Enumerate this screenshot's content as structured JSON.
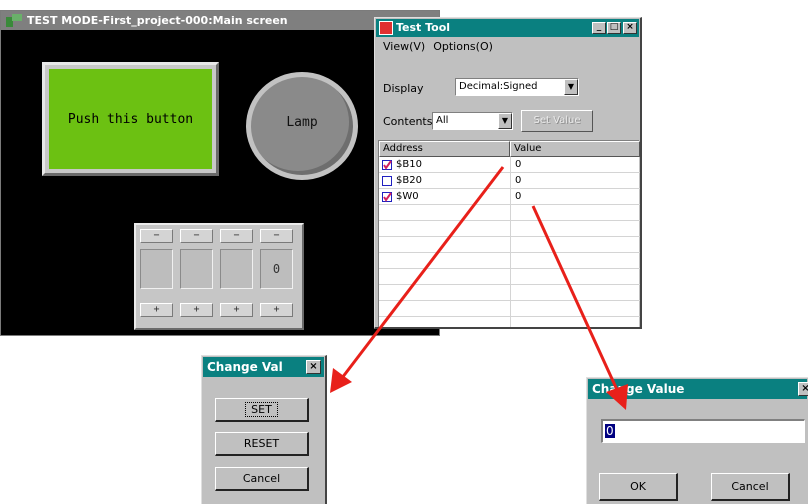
{
  "main_window": {
    "title": "TEST MODE-First_project-000:Main screen",
    "push_button_label": "Push this button",
    "lamp_label": "Lamp",
    "numpad": {
      "minus_labels": [
        "−",
        "−",
        "−",
        "−"
      ],
      "display_values": [
        "",
        "",
        "",
        "0"
      ],
      "plus_labels": [
        "+",
        "+",
        "+",
        "+"
      ]
    }
  },
  "test_tool": {
    "title": "Test Tool",
    "menu": {
      "view": "View(V)",
      "options": "Options(O)"
    },
    "display_label": "Display",
    "display_value": "Decimal:Signed",
    "contents_label": "Contents",
    "contents_value": "All",
    "set_value_button": "Set Value",
    "columns": {
      "address": "Address",
      "value": "Value"
    },
    "rows": [
      {
        "address": "$B10",
        "value": "0"
      },
      {
        "address": "$B20",
        "value": "0"
      },
      {
        "address": "$W0",
        "value": "0"
      }
    ]
  },
  "change_val_dialog": {
    "title": "Change Val",
    "close": "×",
    "set_button": "SET",
    "reset_button": "RESET",
    "cancel_button": "Cancel"
  },
  "change_value_dialog": {
    "title": "Change Value",
    "close": "×",
    "input_value": "0",
    "ok_button": "OK",
    "cancel_button": "Cancel"
  },
  "colors": {
    "titlebar_active": "#0a8080",
    "titlebar_inactive": "#7f7f7f",
    "push_button_face": "#6cc112",
    "arrow": "#e8201a"
  }
}
